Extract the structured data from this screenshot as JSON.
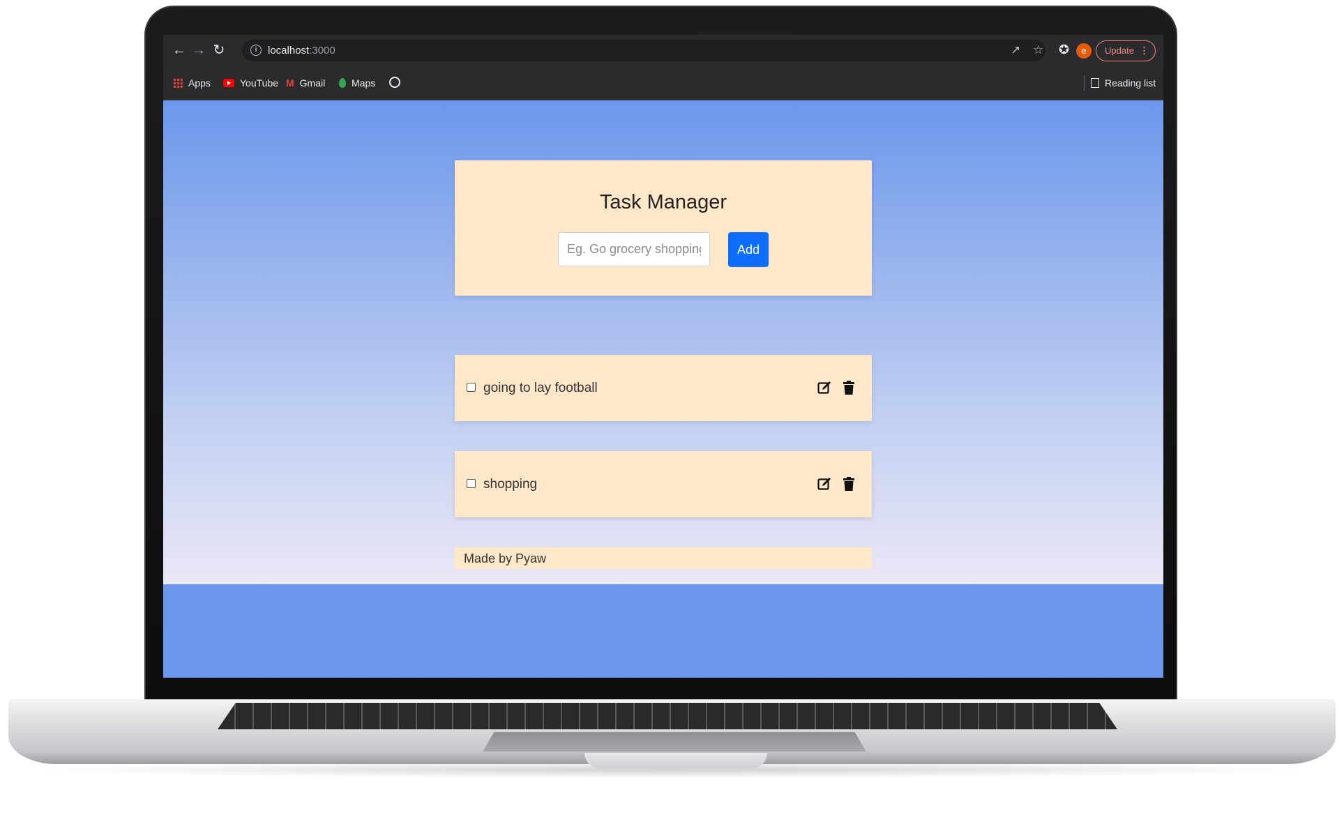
{
  "browser": {
    "url_host": "localhost",
    "url_port": ":3000",
    "update_label": "Update",
    "avatar_initial": "e",
    "bookmarks": [
      {
        "label": "Apps",
        "icon": "apps-grid-icon"
      },
      {
        "label": "YouTube",
        "icon": "youtube-icon"
      },
      {
        "label": "Gmail",
        "icon": "gmail-icon"
      },
      {
        "label": "Maps",
        "icon": "maps-icon"
      }
    ],
    "reading_list_label": "Reading list"
  },
  "app": {
    "title": "Task Manager",
    "input_placeholder": "Eg. Go grocery shopping",
    "add_label": "Add",
    "tasks": [
      {
        "text": "going to lay football",
        "done": false
      },
      {
        "text": "shopping",
        "done": false
      }
    ],
    "footer": "Made by Pyaw"
  },
  "colors": {
    "accent": "#0d6efd",
    "card_bg": "#ffe8c9",
    "page_bg_top": "#6b97ec"
  }
}
